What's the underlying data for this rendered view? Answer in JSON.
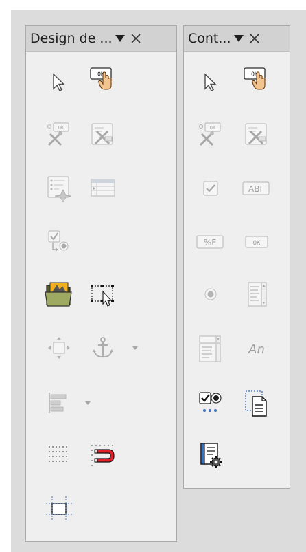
{
  "toolbars": {
    "design": {
      "title": "Design de ...",
      "menu_glyph": "▼",
      "close_glyph": "×"
    },
    "controls": {
      "title": "Cont...",
      "menu_glyph": "▼",
      "close_glyph": "×"
    }
  },
  "buttons": {
    "ok_label": "OK",
    "ab_label": "ABI",
    "pf_label": "%F",
    "an_label": "An"
  },
  "colors": {
    "panel_bg": "#efefef",
    "titlebar_bg": "#d2d2d2",
    "backdrop": "#dcdcdc",
    "magnet_red": "#e0202a",
    "folder_green": "#6f7a3c"
  }
}
